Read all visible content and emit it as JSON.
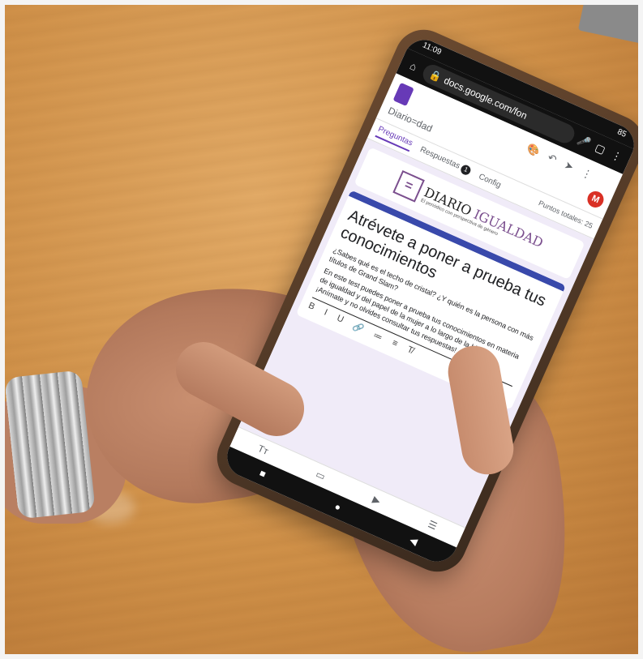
{
  "phone": {
    "status_time": "11:09",
    "battery": "85",
    "url": "docs.google.com/fon"
  },
  "form": {
    "title": "Diario=dad",
    "avatar_initial": "M",
    "tabs": [
      {
        "label": "Preguntas"
      },
      {
        "label": "Respuestas"
      },
      {
        "label": "Config"
      }
    ],
    "responses_badge": "1",
    "points_label": "Puntos totales: 25"
  },
  "banner": {
    "mark": "=",
    "name_part1": "DIARIO",
    "name_part2": "IGUALDAD",
    "tagline": "El periódico con perspectiva de género"
  },
  "card": {
    "heading": "Atrévete a poner a prueba tus conocimientos",
    "question": "¿Sabes qué es el techo de cristal? ¿Y quién es la persona con más títulos de Grand Slam?",
    "description": "En este test puedes poner a prueba tus conocimientos en materia de igualdad y del papel de la mujer a lo largo de la historia. ¡Anímate y no olvides consultar tus respuestas!",
    "format_tools": [
      "B",
      "I",
      "U",
      "🔗",
      "≔",
      "≡",
      "T̸"
    ]
  },
  "bottom_tools": [
    "Tт",
    "▭",
    "▶",
    "☰"
  ],
  "nav": [
    "■",
    "●",
    "◀"
  ],
  "icons": {
    "home": "home-icon",
    "lock": "lock-icon",
    "mic": "mic-icon",
    "tabs": "tabs-icon",
    "menu": "menu-icon",
    "palette": "palette-icon",
    "undo": "undo-icon",
    "send": "send-icon"
  }
}
